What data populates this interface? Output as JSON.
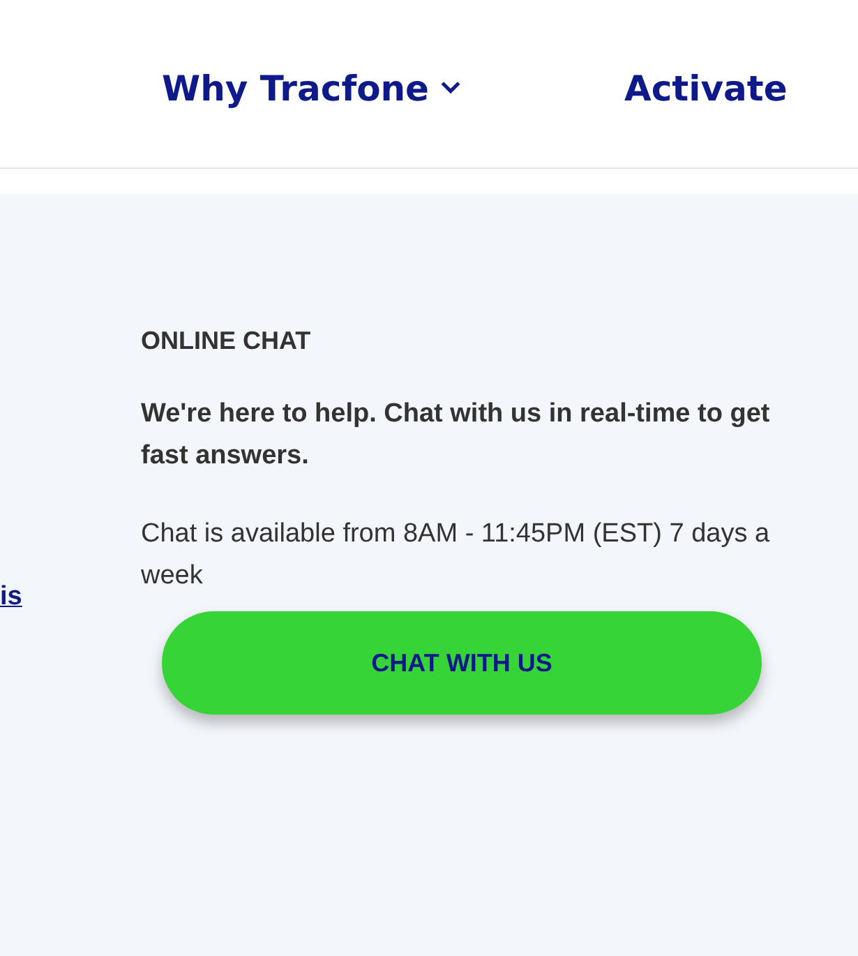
{
  "nav": [
    {
      "label": "Why Tracfone",
      "has_dropdown": true
    },
    {
      "label": "Activate",
      "has_dropdown": false
    }
  ],
  "side_link": "is",
  "chat": {
    "heading": "ONLINE CHAT",
    "intro": "We're here to help. Chat with us in real-time to get fast answers.",
    "hours": "Chat is available from 8AM - 11:45PM (EST) 7 days a week",
    "button": "CHAT WITH US"
  }
}
